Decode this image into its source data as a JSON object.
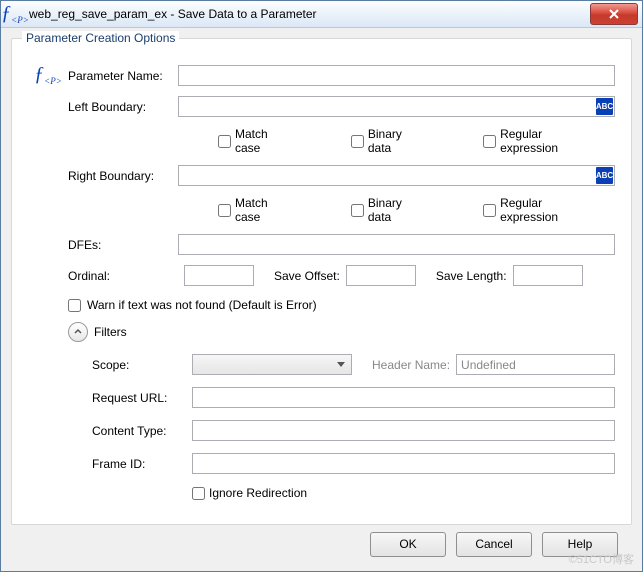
{
  "window": {
    "title": "web_reg_save_param_ex - Save Data to a Parameter"
  },
  "group": {
    "legend": "Parameter Creation Options"
  },
  "labels": {
    "param_name": "Parameter Name:",
    "left_boundary": "Left Boundary:",
    "right_boundary": "Right Boundary:",
    "dfes": "DFEs:",
    "ordinal": "Ordinal:",
    "save_offset": "Save Offset:",
    "save_length": "Save Length:",
    "warn": "Warn if text was not found (Default is Error)",
    "filters": "Filters",
    "scope": "Scope:",
    "header_name": "Header Name:",
    "request_url": "Request URL:",
    "content_type": "Content Type:",
    "frame_id": "Frame ID:",
    "ignore_redirection": "Ignore Redirection"
  },
  "checkboxes": {
    "match_case": "Match case",
    "binary_data": "Binary data",
    "regex": "Regular expression"
  },
  "values": {
    "param_name": "",
    "left_boundary": "",
    "right_boundary": "",
    "dfes": "",
    "ordinal": "",
    "save_offset": "",
    "save_length": "",
    "scope": "",
    "header_name": "Undefined",
    "request_url": "",
    "content_type": "",
    "frame_id": ""
  },
  "badge": "ABC",
  "buttons": {
    "ok": "OK",
    "cancel": "Cancel",
    "help": "Help"
  },
  "watermark": "©51CTO博客"
}
